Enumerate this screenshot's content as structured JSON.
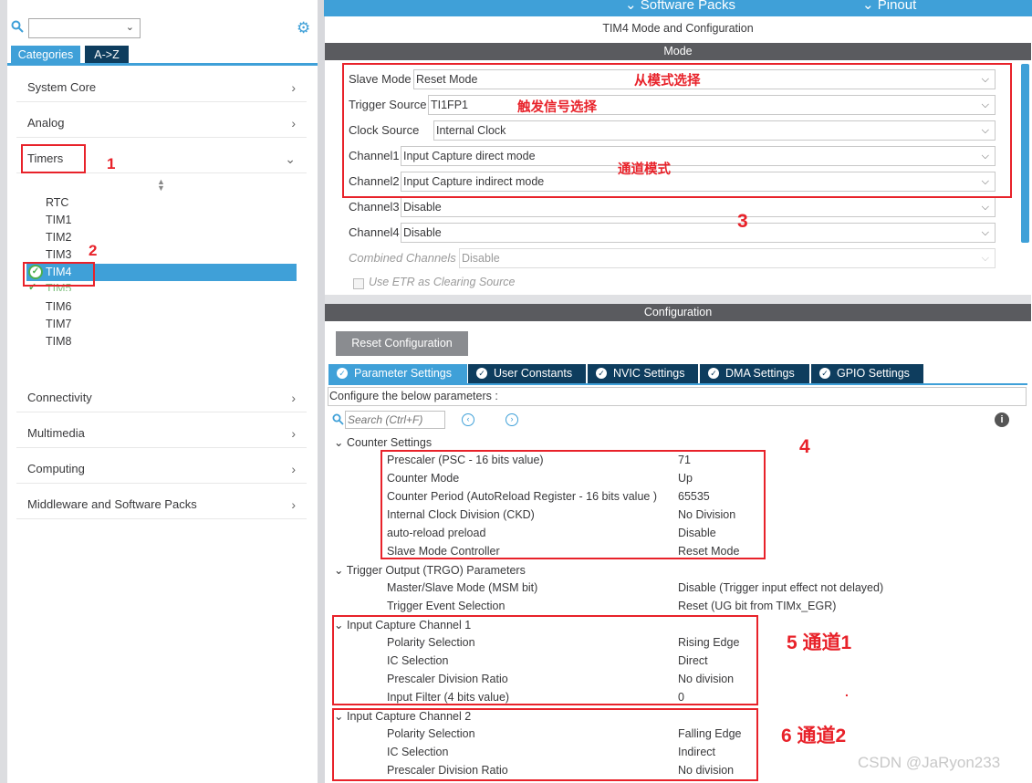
{
  "topbar": {
    "software_packs": "Software Packs",
    "pinout": "Pinout"
  },
  "left": {
    "tab_categories": "Categories",
    "tab_az": "A->Z",
    "nav": [
      {
        "label": "System Core"
      },
      {
        "label": "Analog"
      },
      {
        "label": "Timers"
      }
    ],
    "timers": [
      "RTC",
      "TIM1",
      "TIM2",
      "TIM3",
      "TIM4",
      "TIM5",
      "TIM6",
      "TIM7",
      "TIM8"
    ],
    "nav2": [
      {
        "label": "Connectivity"
      },
      {
        "label": "Multimedia"
      },
      {
        "label": "Computing"
      },
      {
        "label": "Middleware and Software Packs"
      }
    ]
  },
  "annot": {
    "n1": "1",
    "n2": "2",
    "n3": "3",
    "n4": "4",
    "n5": "5 通道1",
    "n6": "6 通道2",
    "slave": "从模式选择",
    "trigger": "触发信号选择",
    "channel": "通道模式",
    "dot": "."
  },
  "title": "TIM4 Mode and Configuration",
  "mode_bar": "Mode",
  "mode": {
    "slave_label": "Slave Mode",
    "slave_value": "Reset Mode",
    "trigger_label": "Trigger Source",
    "trigger_value": "TI1FP1",
    "clock_label": "Clock Source",
    "clock_value": "Internal Clock",
    "ch1_label": "Channel1",
    "ch1_value": "Input Capture direct mode",
    "ch2_label": "Channel2",
    "ch2_value": "Input Capture indirect mode",
    "ch3_label": "Channel3",
    "ch3_value": "Disable",
    "ch4_label": "Channel4",
    "ch4_value": "Disable",
    "comb_label": "Combined Channels",
    "comb_value": "Disable",
    "etr_label": "Use ETR as Clearing Source"
  },
  "config_bar": "Configuration",
  "reset_btn": "Reset Configuration",
  "tabs": [
    "Parameter Settings",
    "User Constants",
    "NVIC Settings",
    "DMA Settings",
    "GPIO Settings"
  ],
  "configure_text": "Configure the below parameters :",
  "search_placeholder": "Search (Ctrl+F)",
  "counter": {
    "title": "Counter Settings",
    "rows": [
      [
        "Prescaler (PSC - 16 bits value)",
        "71"
      ],
      [
        "Counter Mode",
        "Up"
      ],
      [
        "Counter Period (AutoReload Register - 16 bits value )",
        "65535"
      ],
      [
        "Internal Clock Division (CKD)",
        "No Division"
      ],
      [
        "auto-reload preload",
        "Disable"
      ],
      [
        "Slave Mode Controller",
        "Reset Mode"
      ]
    ]
  },
  "trgo": {
    "title": "Trigger Output (TRGO) Parameters",
    "rows": [
      [
        "Master/Slave Mode (MSM bit)",
        "Disable (Trigger input effect not delayed)"
      ],
      [
        "Trigger Event Selection",
        "Reset (UG bit from TIMx_EGR)"
      ]
    ]
  },
  "ic1": {
    "title": "Input Capture Channel 1",
    "rows": [
      [
        "Polarity Selection",
        "Rising Edge"
      ],
      [
        "IC Selection",
        "Direct"
      ],
      [
        "Prescaler Division Ratio",
        "No division"
      ],
      [
        "Input Filter (4 bits value)",
        "0"
      ]
    ]
  },
  "ic2": {
    "title": "Input Capture Channel 2",
    "rows": [
      [
        "Polarity Selection",
        "Falling Edge"
      ],
      [
        "IC Selection",
        "Indirect"
      ],
      [
        "Prescaler Division Ratio",
        "No division"
      ]
    ]
  },
  "watermark": "CSDN @JaRyon233"
}
